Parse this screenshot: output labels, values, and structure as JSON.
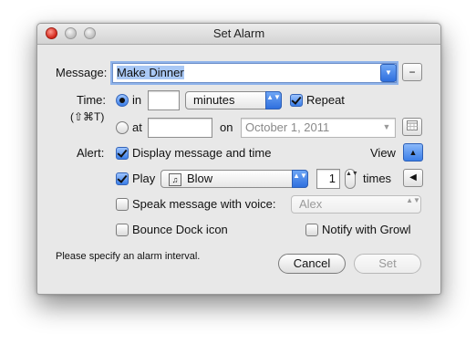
{
  "window": {
    "title": "Set Alarm"
  },
  "message": {
    "label": "Message:",
    "value": "Make Dinner",
    "remove_button": "−"
  },
  "time": {
    "label": "Time:",
    "shortcut": "(⇧⌘T)",
    "in_label": "in",
    "in_value": "",
    "unit_value": "minutes",
    "repeat_label": "Repeat",
    "at_label": "at",
    "at_value": "",
    "on_label": "on",
    "date_value": "October 1, 2011"
  },
  "alert": {
    "label": "Alert:",
    "display_label": "Display message and time",
    "view_label": "View",
    "play_label": "Play",
    "sound_value": "Blow",
    "times_value": "1",
    "times_label": "times",
    "speak_label": "Speak message with voice:",
    "voice_value": "Alex",
    "bounce_label": "Bounce Dock icon",
    "growl_label": "Notify with Growl"
  },
  "status_text": "Please specify an alarm interval.",
  "buttons": {
    "cancel": "Cancel",
    "set": "Set"
  },
  "icons": {
    "popup_arrows": "▲▼",
    "disclosure_up": "▲",
    "down_arrow": "▼",
    "music_note": "♫",
    "speaker": "◀"
  },
  "states": {
    "in_selected": true,
    "repeat_checked": true,
    "display_checked": true,
    "play_checked": true,
    "speak_checked": false,
    "bounce_checked": false,
    "growl_checked": false
  },
  "colors": {
    "accent": "#3b7ee8",
    "selection": "#a9c8f5",
    "window_bg": "#e8e8e8"
  }
}
